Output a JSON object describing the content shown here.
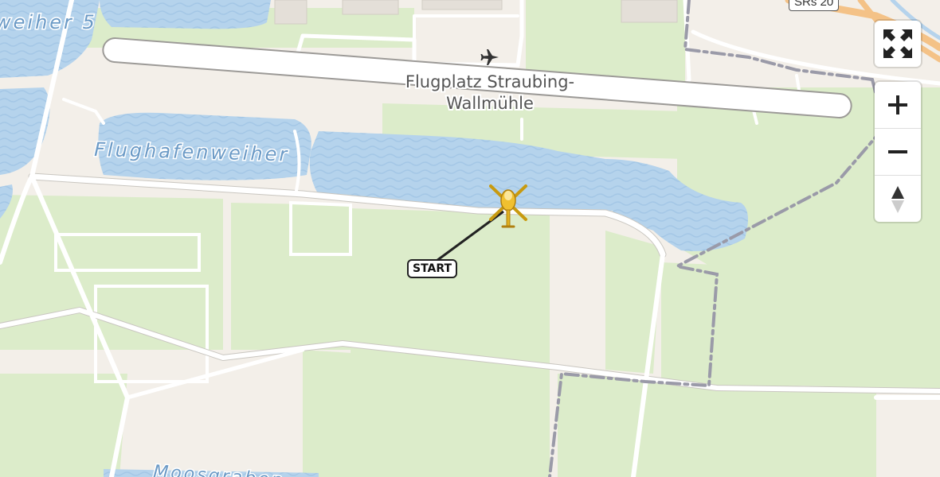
{
  "map": {
    "airport_label_line1": "Flugplatz Straubing-",
    "airport_label_line2": "Wallmühle",
    "water_label_flughafenweiher": "Flughafenweiher",
    "water_label_weiher5": "weiher 5",
    "water_label_moosgraben": "Moosgraben",
    "road_badge": "SRs 20",
    "start_label": "START",
    "airport_icon": "airplane-icon",
    "vehicle_icon": "helicopter-icon",
    "colors": {
      "land": "#f3efe9",
      "green": "#dcecca",
      "water": "#b5d3ec",
      "water_label": "#6b9ac6",
      "runway": "#ffffff",
      "boundary": "#9a9aa8",
      "route": "#222222",
      "helicopter": "#e0b020"
    }
  },
  "controls": {
    "fullscreen_icon": "fullscreen-icon",
    "zoom_in_icon": "plus-icon",
    "zoom_out_icon": "minus-icon",
    "compass_icon": "compass-icon"
  }
}
